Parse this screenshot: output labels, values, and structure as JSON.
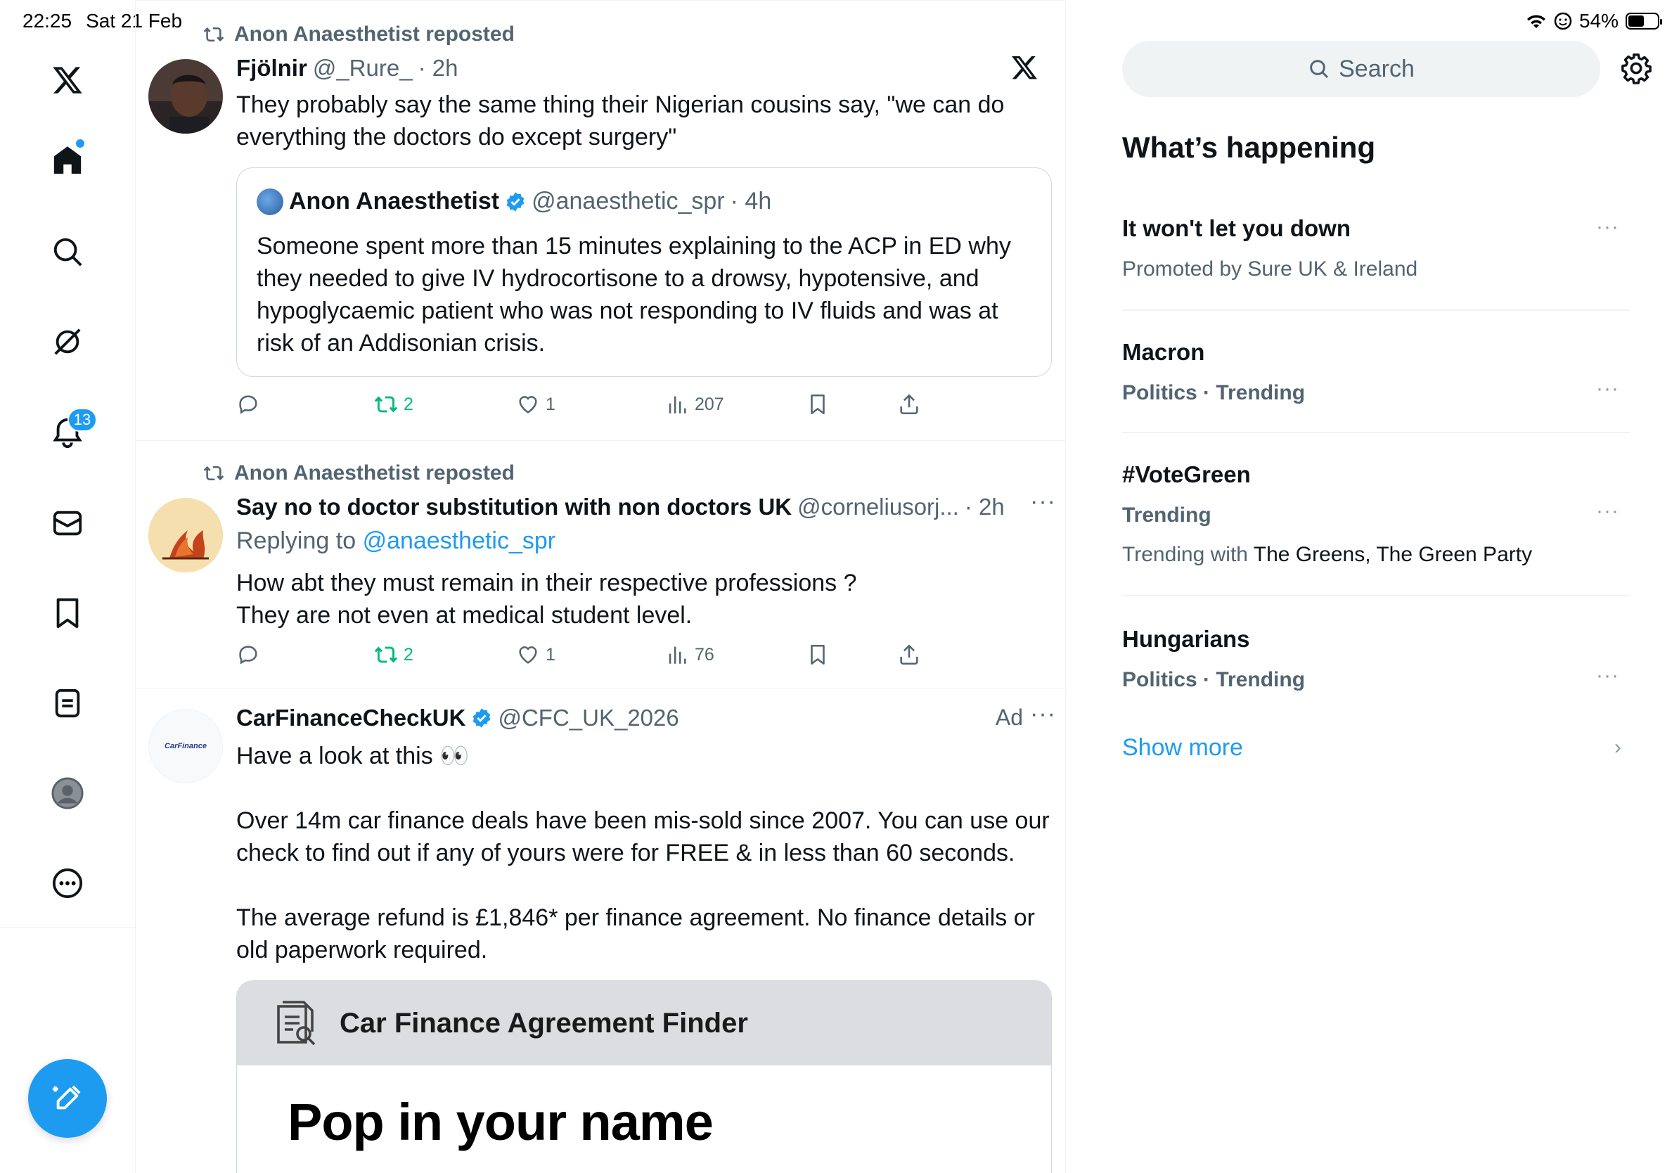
{
  "status_bar": {
    "time": "22:25",
    "date": "Sat 21 Feb",
    "battery": "54%",
    "battery_level": 0.54
  },
  "nav": {
    "notifications_badge": "13"
  },
  "tweets": [
    {
      "reposted_by": "Anon Anaesthetist reposted",
      "name": "Fjölnir",
      "handle": "@_Rure_",
      "time": "· 2h",
      "text_lines": [
        "They probably say the same thing their Nigerian cousins say, \"we can do",
        "everything the doctors do except surgery\""
      ],
      "quote": {
        "name": "Anon Anaesthetist",
        "handle": "@anaesthetic_spr",
        "time": "· 4h",
        "text": "Someone spent more than 15 minutes explaining to the ACP in ED why they needed to give IV hydrocortisone to a drowsy, hypotensive, and hypoglycaemic patient who was not responding to IV fluids and was at risk of an Addisonian crisis."
      },
      "reposts": "2",
      "likes": "1",
      "views": "207"
    },
    {
      "reposted_by": "Anon Anaesthetist reposted",
      "name": "Say no to doctor substitution with non doctors UK",
      "handle": "@corneliusorj...",
      "time": "· 2h",
      "replying_prefix": "Replying to",
      "replying_to": "@anaesthetic_spr",
      "text_lines": [
        "How abt they must remain in their respective professions ?",
        "They are not even at medical student level."
      ],
      "reposts": "2",
      "likes": "1",
      "views": "76"
    },
    {
      "name": "CarFinanceCheckUK",
      "handle": "@CFC_UK_2026",
      "ad_label": "Ad",
      "avatar_logo": "CarFinance",
      "text_intro": "Have a look at this 👀",
      "text_p2": "Over 14m car finance deals have been mis-sold since 2007. You can use our check to find out if any of yours were for FREE & in less than 60 seconds.",
      "text_p3": "The average refund is £1,846* per finance agreement. No finance details or old paperwork required.",
      "card_title": "Car Finance Agreement Finder",
      "card_heading": "Pop in your name"
    }
  ],
  "sidebar": {
    "search_placeholder": "Search",
    "title": "What’s happening",
    "trends": [
      {
        "name": "It won't let you down",
        "sub": "Promoted by Sure UK & Ireland"
      },
      {
        "name": "Macron",
        "sub": "Politics · Trending"
      },
      {
        "name": "#VoteGreen",
        "sub": "Trending",
        "with_prefix": "Trending with",
        "with": "The Greens, The Green Party"
      },
      {
        "name": "Hungarians",
        "sub": "Politics · Trending"
      }
    ],
    "show_more": "Show more"
  },
  "colors": {
    "accent": "#1d9bf0",
    "repost_green": "#00ba7c",
    "secondary_text": "#536471"
  },
  "icons": [
    "x-logo-icon",
    "home-icon",
    "search-icon",
    "grok-icon",
    "bell-icon",
    "mail-icon",
    "bookmark-icon",
    "lists-icon",
    "profile-icon",
    "more-icon",
    "compose-icon",
    "reply-icon",
    "repost-icon",
    "like-icon",
    "views-icon",
    "share-icon",
    "gear-icon"
  ]
}
